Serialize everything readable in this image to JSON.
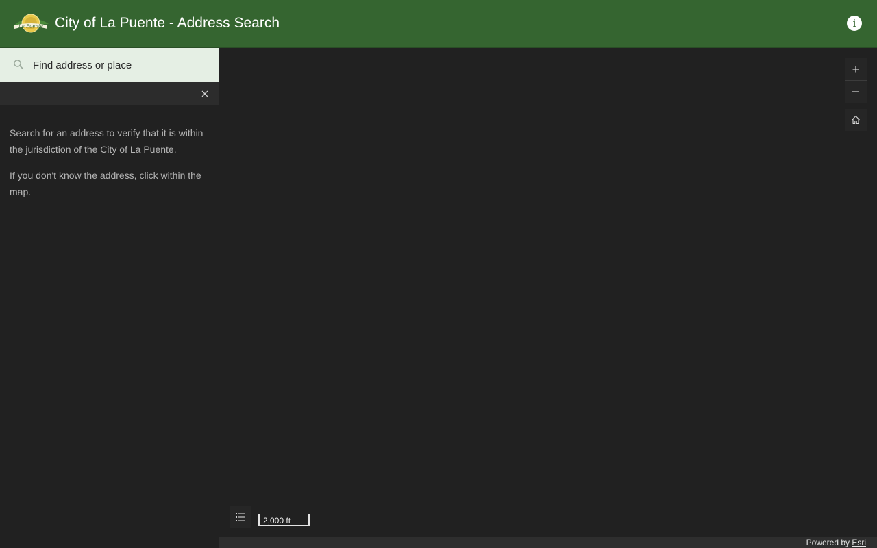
{
  "header": {
    "title": "City of La Puente - Address Search",
    "logo_text": "La Puente",
    "info_icon": "info-icon",
    "background": "#356530"
  },
  "search": {
    "placeholder": "Find address or place",
    "value": "",
    "icon": "search-icon",
    "background": "#e5efe4"
  },
  "results": {
    "clear_icon": "close-icon"
  },
  "instructions": [
    "Search for an address to verify that it is within the jurisdiction of the City of La Puente.",
    "If you don't know the address, click within the map."
  ],
  "map_controls": {
    "zoom_in_icon": "plus-icon",
    "zoom_out_icon": "minus-icon",
    "home_icon": "home-icon",
    "legend_icon": "list-icon"
  },
  "scalebar": {
    "label": "2,000 ft"
  },
  "attribution": {
    "prefix": "Powered by ",
    "link": "Esri"
  }
}
